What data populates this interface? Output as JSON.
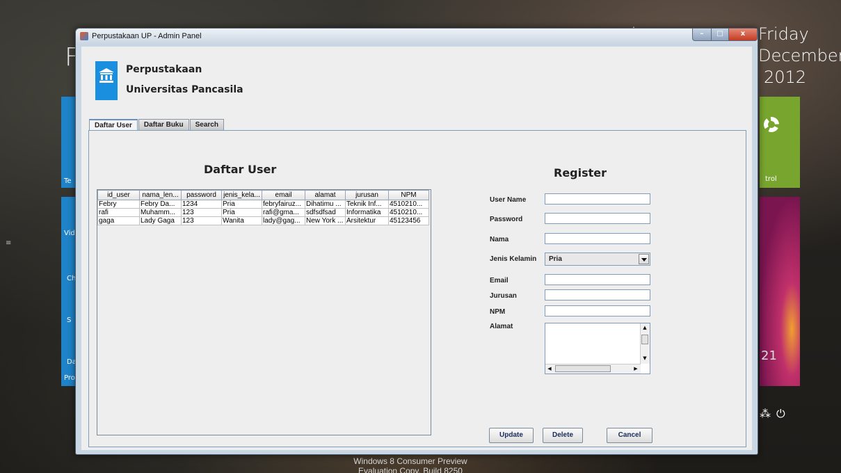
{
  "desktop": {
    "big_letter": "F",
    "date": {
      "day": "Friday",
      "month": "December",
      "year": "2012"
    },
    "left_tile_labels": [
      "Te",
      "Vid",
      "Ch",
      "S",
      "Da",
      "Pro"
    ],
    "right_tile_label": "trol",
    "right_date_partial": "21",
    "watermark_line1": "Windows 8 Consumer Preview",
    "watermark_line2": "Evaluation Copy. Build 8250"
  },
  "window": {
    "title": "Perpustakaan UP - Admin Panel",
    "controls": {
      "minimize": "–",
      "maximize": "□",
      "close": "x"
    }
  },
  "brand": {
    "line1": "Perpustakaan",
    "line2": "Universitas Pancasila"
  },
  "tabs": [
    "Daftar User",
    "Daftar Buku",
    "Search"
  ],
  "active_tab": "Daftar User",
  "user_list": {
    "title": "Daftar User",
    "columns": [
      "id_user",
      "nama_len...",
      "password",
      "jenis_kela...",
      "email",
      "alamat",
      "jurusan",
      "NPM"
    ],
    "rows": [
      [
        "Febry",
        "Febry Da...",
        "1234",
        "Pria",
        "febryfairuz...",
        "Dihatimu ...",
        "Teknik Inf...",
        "4510210..."
      ],
      [
        "rafi",
        "Muhamm...",
        "123",
        "Pria",
        "rafi@gma...",
        "sdfsdfsad",
        "Informatika",
        "4510210..."
      ],
      [
        "gaga",
        "Lady Gaga",
        "123",
        "Wanita",
        "lady@gag...",
        "New York ...",
        "Arsitektur",
        "45123456"
      ]
    ]
  },
  "register": {
    "title": "Register",
    "labels": {
      "username": "User Name",
      "password": "Password",
      "nama": "Nama",
      "jenis_kelamin": "Jenis Kelamin",
      "email": "Email",
      "jurusan": "Jurusan",
      "npm": "NPM",
      "alamat": "Alamat"
    },
    "values": {
      "username": "",
      "password": "",
      "nama": "",
      "email": "",
      "jurusan": "",
      "npm": "",
      "alamat": ""
    },
    "jenis_kelamin_selected": "Pria",
    "buttons": {
      "update": "Update",
      "delete": "Delete",
      "cancel": "Cancel"
    }
  },
  "colors": {
    "accent_blue": "#1a8fe0",
    "tile_green": "#77a52e",
    "tile_blue": "#1e83c8",
    "close_red": "#c43b22"
  }
}
